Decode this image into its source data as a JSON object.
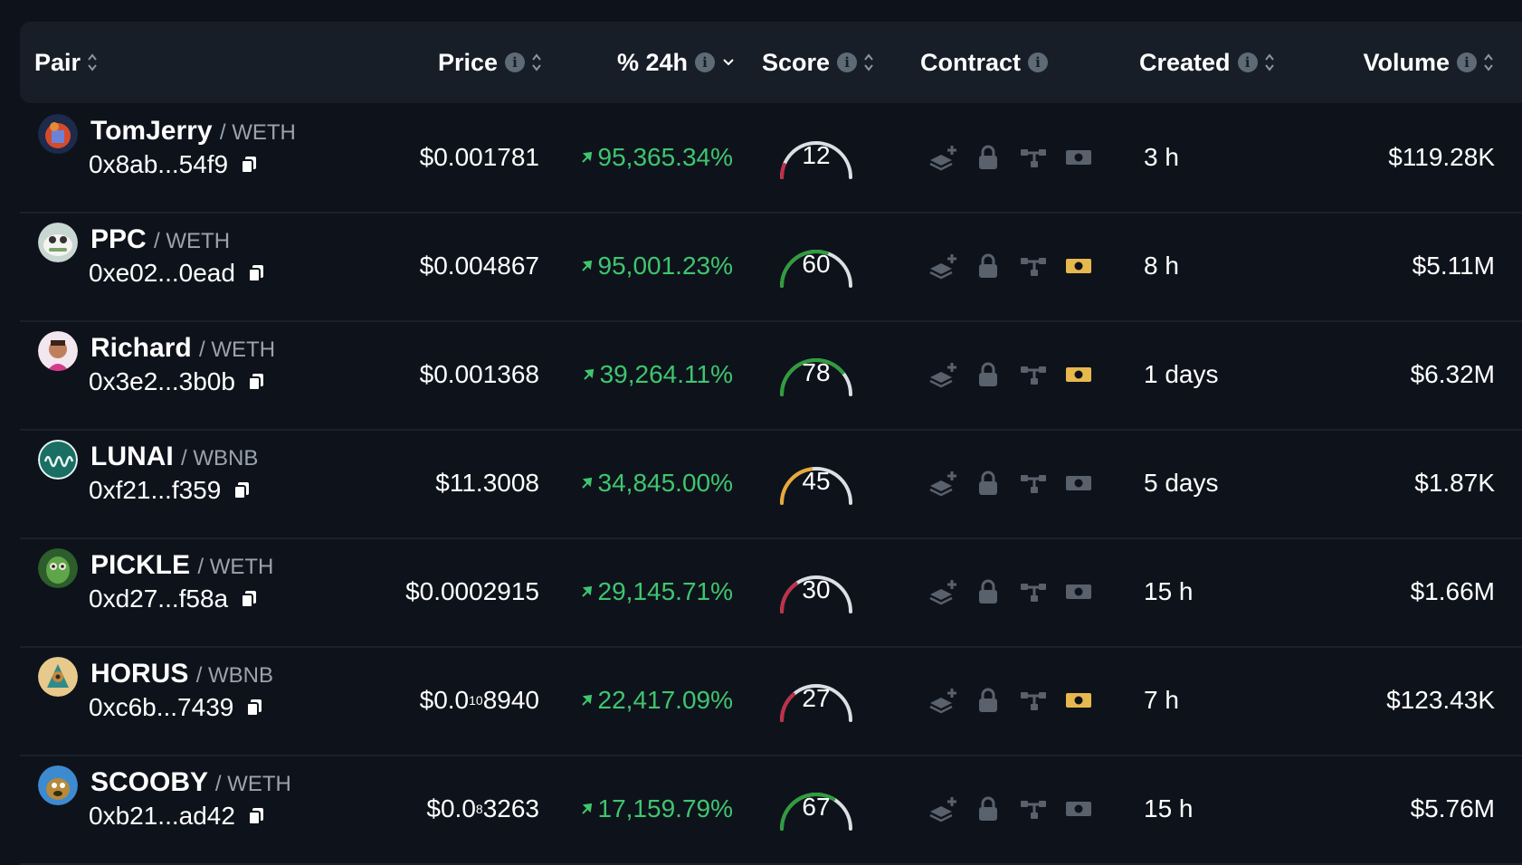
{
  "headers": {
    "pair": "Pair",
    "price": "Price",
    "change": "% 24h",
    "score": "Score",
    "contract": "Contract",
    "created": "Created",
    "volume": "Volume"
  },
  "colors": {
    "positive": "#3fc56f",
    "score_low": "#c0304a",
    "score_mid": "#e8a93a",
    "score_high": "#2f9d3c",
    "money_active": "#e7b84d",
    "icon_muted": "#59616c"
  },
  "rows": [
    {
      "name": "TomJerry",
      "quote": "/ WETH",
      "address": "0x8ab...54f9",
      "price_main": "$0.001781",
      "price_sub": "",
      "price_tail": "",
      "change": "95,365.34%",
      "score": "12",
      "created": "3 h",
      "volume": "$119.28K",
      "money_active": false,
      "avatar": "avatar-tomjerry"
    },
    {
      "name": "PPC",
      "quote": "/ WETH",
      "address": "0xe02...0ead",
      "price_main": "$0.004867",
      "price_sub": "",
      "price_tail": "",
      "change": "95,001.23%",
      "score": "60",
      "created": "8 h",
      "volume": "$5.11M",
      "money_active": true,
      "avatar": "avatar-ppc"
    },
    {
      "name": "Richard",
      "quote": "/ WETH",
      "address": "0x3e2...3b0b",
      "price_main": "$0.001368",
      "price_sub": "",
      "price_tail": "",
      "change": "39,264.11%",
      "score": "78",
      "created": "1 days",
      "volume": "$6.32M",
      "money_active": true,
      "avatar": "avatar-richard"
    },
    {
      "name": "LUNAI",
      "quote": "/ WBNB",
      "address": "0xf21...f359",
      "price_main": "$11.3008",
      "price_sub": "",
      "price_tail": "",
      "change": "34,845.00%",
      "score": "45",
      "created": "5 days",
      "volume": "$1.87K",
      "money_active": false,
      "avatar": "avatar-lunai"
    },
    {
      "name": "PICKLE",
      "quote": "/ WETH",
      "address": "0xd27...f58a",
      "price_main": "$0.0002915",
      "price_sub": "",
      "price_tail": "",
      "change": "29,145.71%",
      "score": "30",
      "created": "15 h",
      "volume": "$1.66M",
      "money_active": false,
      "avatar": "avatar-pickle"
    },
    {
      "name": "HORUS",
      "quote": "/ WBNB",
      "address": "0xc6b...7439",
      "price_main": "$0.0",
      "price_sub": "10",
      "price_tail": "8940",
      "change": "22,417.09%",
      "score": "27",
      "created": "7 h",
      "volume": "$123.43K",
      "money_active": true,
      "avatar": "avatar-horus"
    },
    {
      "name": "SCOOBY",
      "quote": "/ WETH",
      "address": "0xb21...ad42",
      "price_main": "$0.0",
      "price_sub": "8",
      "price_tail": "3263",
      "change": "17,159.79%",
      "score": "67",
      "created": "15 h",
      "volume": "$5.76M",
      "money_active": false,
      "avatar": "avatar-scooby"
    }
  ]
}
